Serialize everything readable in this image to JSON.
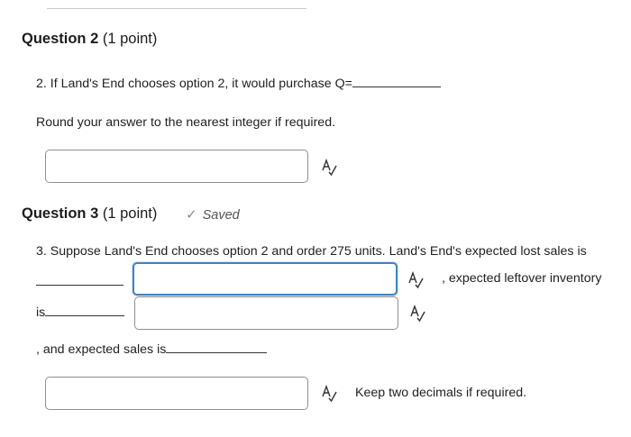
{
  "question2": {
    "title": "Question 2",
    "points": "(1 point)",
    "prompt": "2. If Land's End chooses option 2, it would purchase Q=",
    "note": "Round your answer to the nearest integer if required.",
    "answer_value": "",
    "spellcheck_icon": "spellcheck-icon"
  },
  "question3": {
    "title": "Question 3",
    "points": "(1 point)",
    "saved_label": "Saved",
    "saved_icon": "checkmark-icon",
    "prompt_line1": "3. Suppose Land's End chooses option 2 and order 275 units. Land's End's expected lost sales is",
    "after_first_field": ", expected leftover inventory",
    "is_label": "is",
    "and_sales_label": ", and expected sales is",
    "keep_note": "Keep two decimals if required.",
    "lost_sales_value": "",
    "leftover_inventory_value": "",
    "expected_sales_value": "",
    "spellcheck_icon": "spellcheck-icon"
  }
}
